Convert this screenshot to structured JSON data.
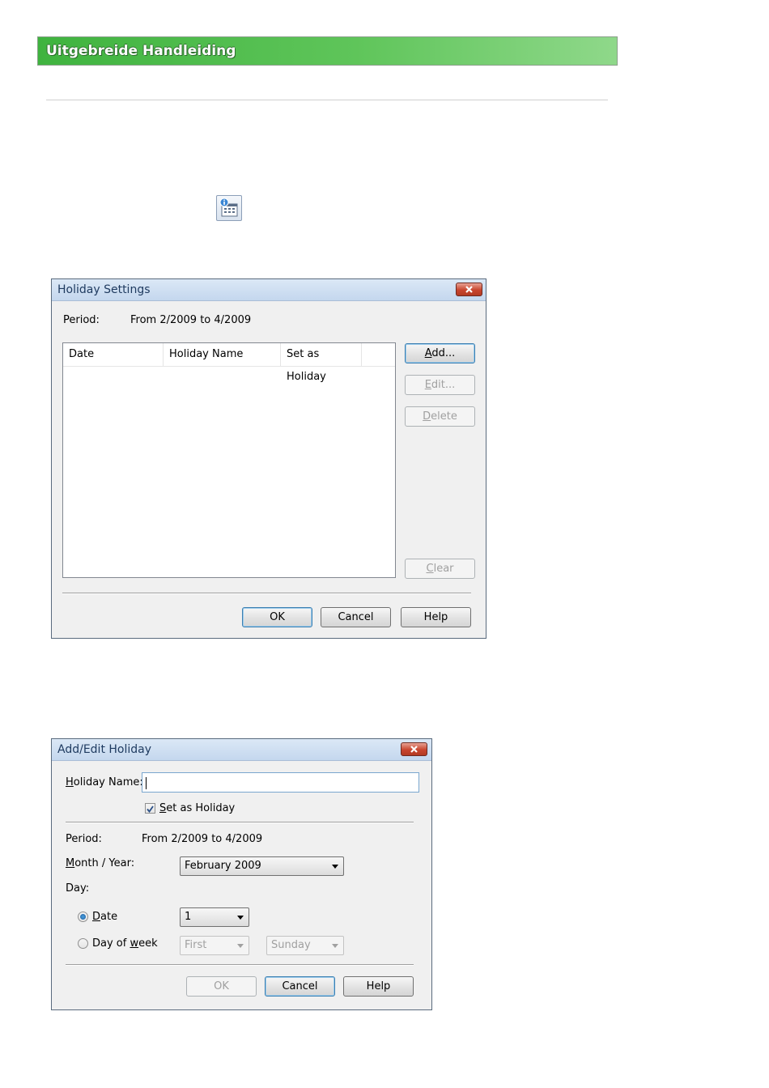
{
  "banner": {
    "title": "Uitgebreide Handleiding"
  },
  "icons": {
    "toolbar": "holiday-settings-icon",
    "close": "close-icon",
    "check": "checkmark-icon"
  },
  "colors": {
    "banner_green": "#4cbc48",
    "title_bar": "#c4d7ee",
    "close_red": "#c8452f"
  },
  "holiday_settings": {
    "title": "Holiday Settings",
    "period_label": "Period:",
    "period_value": "From 2/2009 to 4/2009",
    "columns": [
      "Date",
      "Holiday Name",
      "Set as Holiday"
    ],
    "rows": [],
    "buttons": {
      "add": {
        "ul": "A",
        "rest": "dd...",
        "enabled": true
      },
      "edit": {
        "ul": "E",
        "rest": "dit...",
        "enabled": false
      },
      "delete": {
        "ul": "D",
        "rest": "elete",
        "enabled": false
      },
      "clear": {
        "ul": "C",
        "rest": "lear",
        "enabled": false
      },
      "ok": "OK",
      "cancel": "Cancel",
      "help": "Help"
    }
  },
  "add_edit_holiday": {
    "title": "Add/Edit Holiday",
    "holiday_name_label_ul": "H",
    "holiday_name_label_rest": "oliday Name:",
    "holiday_name_value": "",
    "set_as_holiday_ul": "S",
    "set_as_holiday_rest": "et as Holiday",
    "set_as_holiday_checked": true,
    "period_label": "Period:",
    "period_value": "From 2/2009 to 4/2009",
    "month_year_label_ul": "M",
    "month_year_label_rest": "onth / Year:",
    "month_year_value": "February 2009",
    "day_label": "Day:",
    "date_option_ul": "D",
    "date_option_rest": "ate",
    "date_selected": true,
    "date_value": "1",
    "dow_option_pre": "Day of ",
    "dow_option_ul": "w",
    "dow_option_rest": "eek",
    "dow_selected": false,
    "week_value": "First",
    "weekday_value": "Sunday",
    "buttons": {
      "ok": "OK",
      "cancel": "Cancel",
      "help": "Help"
    }
  }
}
